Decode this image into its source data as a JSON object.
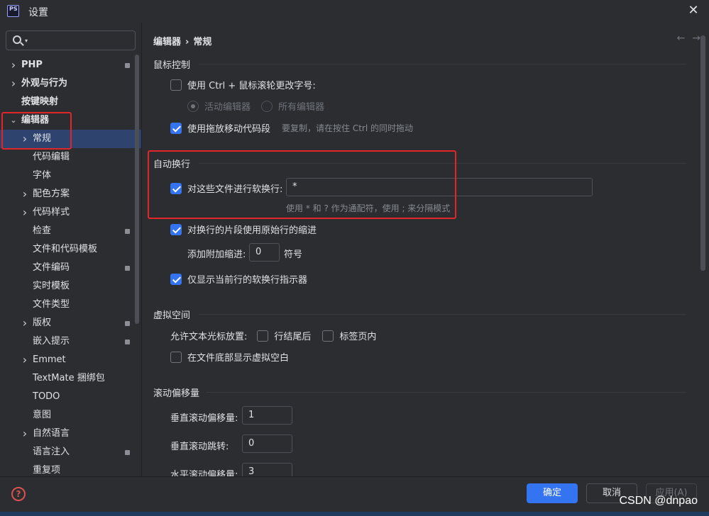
{
  "window": {
    "logo": "PS",
    "title": "设置",
    "close": "✕"
  },
  "search": {
    "placeholder": ""
  },
  "tree": [
    {
      "label": "PHP",
      "chev": "›",
      "bold": true,
      "badge": true
    },
    {
      "label": "外观与行为",
      "chev": "›",
      "bold": true,
      "badge": false
    },
    {
      "label": "按键映射",
      "chev": "",
      "bold": true,
      "badge": false
    },
    {
      "label": "编辑器",
      "chev": "⌄",
      "bold": true,
      "badge": false
    },
    {
      "label": "常规",
      "chev": "›",
      "bold": false,
      "badge": false,
      "selected": true
    },
    {
      "label": "代码编辑",
      "chev": "",
      "bold": false,
      "badge": false
    },
    {
      "label": "字体",
      "chev": "",
      "bold": false,
      "badge": false
    },
    {
      "label": "配色方案",
      "chev": "›",
      "bold": false,
      "badge": false
    },
    {
      "label": "代码样式",
      "chev": "›",
      "bold": false,
      "badge": false
    },
    {
      "label": "检查",
      "chev": "",
      "bold": false,
      "badge": true
    },
    {
      "label": "文件和代码模板",
      "chev": "",
      "bold": false,
      "badge": false
    },
    {
      "label": "文件编码",
      "chev": "",
      "bold": false,
      "badge": true
    },
    {
      "label": "实时模板",
      "chev": "",
      "bold": false,
      "badge": false
    },
    {
      "label": "文件类型",
      "chev": "",
      "bold": false,
      "badge": false
    },
    {
      "label": "版权",
      "chev": "›",
      "bold": false,
      "badge": true
    },
    {
      "label": "嵌入提示",
      "chev": "",
      "bold": false,
      "badge": true
    },
    {
      "label": "Emmet",
      "chev": "›",
      "bold": false,
      "badge": false
    },
    {
      "label": "TextMate 捆绑包",
      "chev": "",
      "bold": false,
      "badge": false
    },
    {
      "label": "TODO",
      "chev": "",
      "bold": false,
      "badge": false
    },
    {
      "label": "意图",
      "chev": "",
      "bold": false,
      "badge": false
    },
    {
      "label": "自然语言",
      "chev": "›",
      "bold": false,
      "badge": false
    },
    {
      "label": "语言注入",
      "chev": "",
      "bold": false,
      "badge": true
    },
    {
      "label": "重复项",
      "chev": "",
      "bold": false,
      "badge": false
    }
  ],
  "breadcrumb": {
    "part1": "编辑器",
    "sep": "›",
    "part2": "常规"
  },
  "nav": {
    "back": "←",
    "forward": "→"
  },
  "mouse": {
    "title": "鼠标控制",
    "ctrl_wheel": "使用 Ctrl + 鼠标滚轮更改字号:",
    "active_editor": "活动编辑器",
    "all_editors": "所有编辑器",
    "drag_move": "使用拖放移动代码段",
    "drag_hint": "要复制，请在按住 Ctrl 的同时拖动"
  },
  "softwrap": {
    "title": "自动换行",
    "files_label": "对这些文件进行软换行:",
    "files_value": "*",
    "files_hint": "使用 * 和 ? 作为通配符，使用 ; 来分隔模式",
    "original_indent": "对换行的片段使用原始行的缩进",
    "extra_indent_label": "添加附加缩进:",
    "extra_indent_value": "0",
    "extra_indent_unit": "符号",
    "current_line_indicator": "仅显示当前行的软换行指示器"
  },
  "virtual": {
    "title": "虚拟空间",
    "allow_label": "允许文本光标放置:",
    "after_eol": "行结尾后",
    "inside_tabs": "标签页内",
    "show_bottom": "在文件底部显示虚拟空白"
  },
  "scroll": {
    "title": "滚动偏移量",
    "vertical_offset_label": "垂直滚动偏移量:",
    "vertical_offset_value": "1",
    "vertical_jump_label": "垂直滚动跳转:",
    "vertical_jump_value": "0",
    "horizontal_offset_label": "水平滚动偏移量:",
    "horizontal_offset_value": "3"
  },
  "footer": {
    "help": "?",
    "ok": "确定",
    "cancel": "取消",
    "apply": "应用(A)"
  },
  "watermark": "CSDN @dnpao",
  "colors": {
    "accent": "#3574f0",
    "highlight": "#e1262a",
    "selected_row": "#2e436e"
  }
}
